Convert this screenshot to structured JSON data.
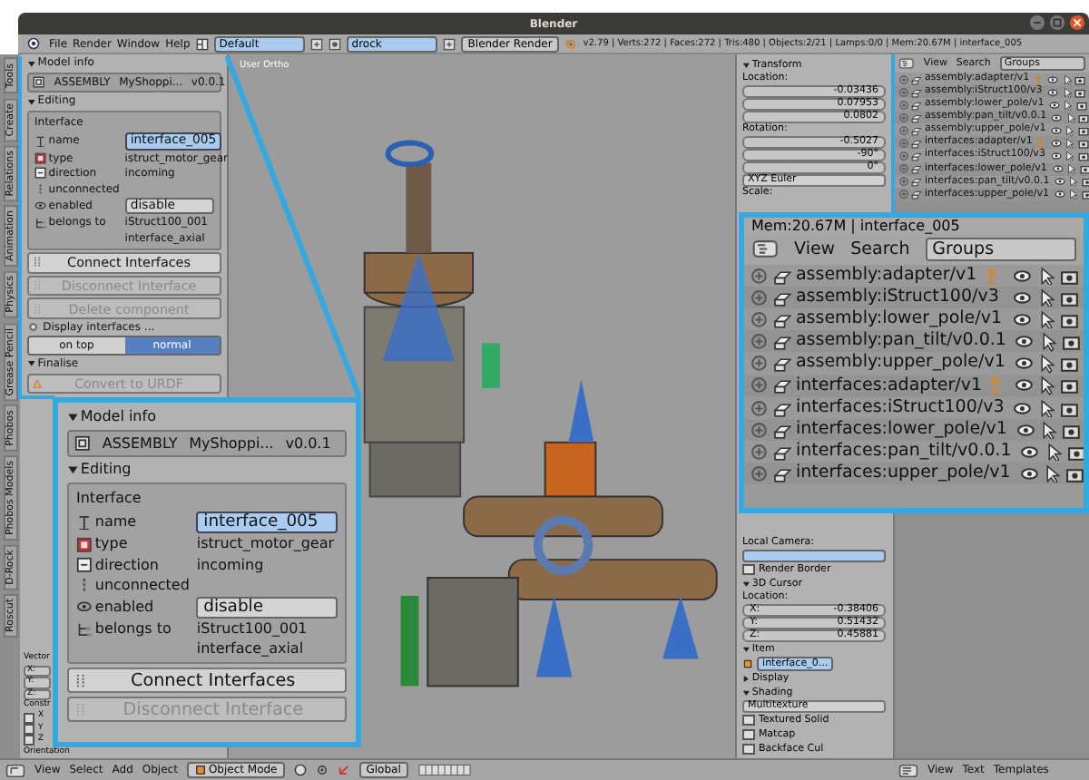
{
  "window": {
    "title": "Blender"
  },
  "info_header": {
    "menus": [
      "File",
      "Render",
      "Window",
      "Help"
    ],
    "screen": "Default",
    "scene": "drock",
    "engine": "Blender Render",
    "stats": "v2.79 | Verts:272 | Faces:272 | Tris:480 | Objects:2/21 | Lamps:0/0 | Mem:20.67M | interface_005"
  },
  "tool_tabs": [
    "Tools",
    "Create",
    "Relations",
    "Animation",
    "Physics",
    "Grease Pencil",
    "Phobos",
    "Phobos Models",
    "D-Rock",
    "Roscut"
  ],
  "tool_panel": {
    "model_info": {
      "title": "Model info",
      "expanded": true,
      "type": "ASSEMBLY",
      "name": "MyShoppi...",
      "version": "v0.0.1"
    },
    "editing": {
      "title": "Editing",
      "expanded": true,
      "box_title": "Interface",
      "properties": [
        {
          "label": "name",
          "value": "interface_005",
          "kind": "field"
        },
        {
          "label": "type",
          "value": "istruct_motor_gear",
          "kind": "text"
        },
        {
          "label": "direction",
          "value": "incoming",
          "kind": "text"
        },
        {
          "label": "unconnected",
          "kind": "text"
        },
        {
          "label": "enabled",
          "value": "disable",
          "kind": "button"
        },
        {
          "label": "belongs to",
          "value": "iStruct100_001",
          "kind": "text"
        },
        {
          "value": "interface_axial",
          "kind": "text"
        }
      ]
    },
    "buttons": [
      {
        "label": "Connect Interfaces",
        "disabled": false
      },
      {
        "label": "Disconnect Interface",
        "disabled": true
      },
      {
        "label": "Delete component",
        "disabled": true
      }
    ],
    "display": {
      "label": "Display interfaces ...",
      "options": [
        {
          "label": "on top",
          "selected": false
        },
        {
          "label": "normal",
          "selected": true
        }
      ]
    },
    "finalise": {
      "title": "Finalise",
      "expanded": true,
      "buttons": [
        {
          "label": "Convert to URDF",
          "disabled": true
        }
      ]
    },
    "operator": {
      "vector_label": "Vector",
      "axes": [
        "X:",
        "Y:",
        "Z:"
      ],
      "constraint_label": "Constr",
      "constraints": [
        {
          "label": "X",
          "checked": false
        },
        {
          "label": "Y",
          "checked": false
        },
        {
          "label": "Z",
          "checked": false
        }
      ],
      "orientation_label": "Orientation"
    }
  },
  "viewport": {
    "view_label": "User Ortho"
  },
  "zoom_inset_left": {
    "model_info": {
      "title": "Model info",
      "expanded": true,
      "type": "ASSEMBLY",
      "name": "MyShoppi...",
      "version": "v0.0.1"
    },
    "editing": {
      "title": "Editing",
      "expanded": true,
      "box_title": "Interface",
      "properties": [
        {
          "label": "name",
          "value": "interface_005",
          "kind": "field"
        },
        {
          "label": "type",
          "value": "istruct_motor_gear",
          "kind": "text"
        },
        {
          "label": "direction",
          "value": "incoming",
          "kind": "text"
        },
        {
          "label": "unconnected",
          "kind": "text"
        },
        {
          "label": "enabled",
          "value": "disable",
          "kind": "button"
        },
        {
          "label": "belongs to",
          "value": "iStruct100_001",
          "kind": "text"
        },
        {
          "value": "interface_axial",
          "kind": "text"
        }
      ]
    },
    "buttons": [
      {
        "label": "Connect Interfaces",
        "disabled": false
      },
      {
        "label": "Disconnect Interface",
        "disabled": true
      }
    ]
  },
  "properties_panel": {
    "transform": {
      "title": "Transform",
      "expanded": true,
      "location_label": "Location:",
      "location": [
        "-0.03436",
        "0.07953",
        "0.0802"
      ],
      "rotation_label": "Rotation:",
      "rotation": [
        "-0.5027",
        "-90°",
        "0°"
      ],
      "rotation_mode": "XYZ Euler",
      "scale_label": "Scale:"
    },
    "local_camera_label": "Local Camera:",
    "render_border": {
      "label": "Render Border",
      "checked": false
    },
    "cursor": {
      "title": "3D Cursor",
      "expanded": true,
      "location_label": "Location:",
      "axes": [
        {
          "label": "X:",
          "value": "-0.38406"
        },
        {
          "label": "Y:",
          "value": "0.51432"
        },
        {
          "label": "Z:",
          "value": "0.45881"
        }
      ]
    },
    "item": {
      "title": "Item",
      "expanded": true,
      "name": "interface_0..."
    },
    "display": {
      "title": "Display",
      "expanded": false
    },
    "shading": {
      "title": "Shading",
      "expanded": true,
      "mode": "Multitexture",
      "options": [
        {
          "label": "Textured Solid",
          "checked": false
        },
        {
          "label": "Matcap",
          "checked": false
        },
        {
          "label": "Backface Cul",
          "checked": false
        }
      ]
    }
  },
  "outliner": {
    "menus": [
      "View",
      "Search"
    ],
    "display_mode": "Groups",
    "rows": [
      {
        "label": "assembly:adapter/v1",
        "has_armature": true
      },
      {
        "label": "assembly:iStruct100/v3",
        "has_armature": false
      },
      {
        "label": "assembly:lower_pole/v1",
        "has_armature": false
      },
      {
        "label": "assembly:pan_tilt/v0.0.1",
        "has_armature": false
      },
      {
        "label": "assembly:upper_pole/v1",
        "has_armature": false
      },
      {
        "label": "interfaces:adapter/v1",
        "has_armature": true
      },
      {
        "label": "interfaces:iStruct100/v3",
        "has_armature": false
      },
      {
        "label": "interfaces:lower_pole/v1",
        "has_armature": false
      },
      {
        "label": "interfaces:pan_tilt/v0.0.1",
        "has_armature": false
      },
      {
        "label": "interfaces:upper_pole/v1",
        "has_armature": false
      }
    ]
  },
  "zoom_inset_right": {
    "status_text": "Mem:20.67M | interface_005",
    "menus": [
      "View",
      "Search"
    ],
    "display_mode": "Groups",
    "rows": [
      {
        "label": "assembly:adapter/v1",
        "has_armature": true
      },
      {
        "label": "assembly:iStruct100/v3",
        "has_armature": false
      },
      {
        "label": "assembly:lower_pole/v1",
        "has_armature": false
      },
      {
        "label": "assembly:pan_tilt/v0.0.1",
        "has_armature": false
      },
      {
        "label": "assembly:upper_pole/v1",
        "has_armature": false
      },
      {
        "label": "interfaces:adapter/v1",
        "has_armature": true
      },
      {
        "label": "interfaces:iStruct100/v3",
        "has_armature": false
      },
      {
        "label": "interfaces:lower_pole/v1",
        "has_armature": false
      },
      {
        "label": "interfaces:pan_tilt/v0.0.1",
        "has_armature": false
      },
      {
        "label": "interfaces:upper_pole/v1",
        "has_armature": false
      }
    ]
  },
  "view3d_header": {
    "menus": [
      "View",
      "Select",
      "Add",
      "Object"
    ],
    "mode": "Object Mode",
    "orientation": "Global"
  },
  "text_editor_header": {
    "menus": [
      "View",
      "Text",
      "Templates"
    ]
  }
}
